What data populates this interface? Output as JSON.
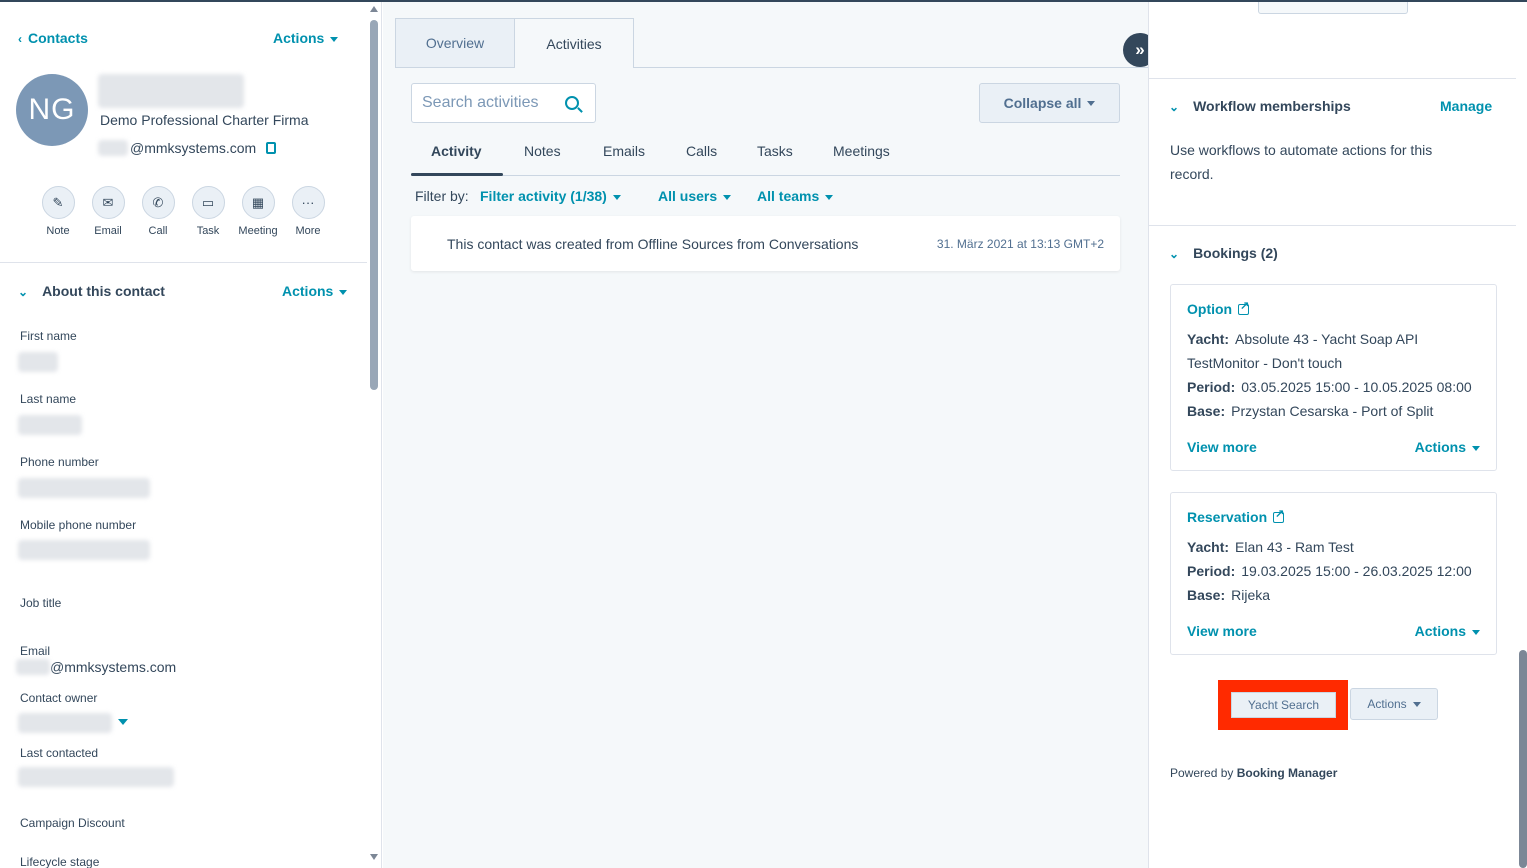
{
  "left": {
    "back_label": "Contacts",
    "header_actions": "Actions",
    "avatar_initials": "NG",
    "company": "Demo Professional Charter Firma",
    "email_domain": "@mmksystems.com",
    "quick_actions": [
      {
        "label": "Note",
        "icon": "edit-icon"
      },
      {
        "label": "Email",
        "icon": "envelope-icon"
      },
      {
        "label": "Call",
        "icon": "phone-icon"
      },
      {
        "label": "Task",
        "icon": "task-icon"
      },
      {
        "label": "Meeting",
        "icon": "calendar-icon"
      },
      {
        "label": "More",
        "icon": "more-icon"
      }
    ],
    "section_title": "About this contact",
    "section_actions": "Actions",
    "props": {
      "first_name": "First name",
      "last_name": "Last name",
      "phone": "Phone number",
      "mobile": "Mobile phone number",
      "job_title": "Job title",
      "email": "Email",
      "email_value": "@mmksystems.com",
      "owner": "Contact owner",
      "last_contacted": "Last contacted",
      "campaign": "Campaign Discount",
      "lifecycle": "Lifecycle stage"
    }
  },
  "mid": {
    "tabs": [
      "Overview",
      "Activities"
    ],
    "search_placeholder": "Search activities",
    "collapse_label": "Collapse all",
    "subtabs": [
      "Activity",
      "Notes",
      "Emails",
      "Calls",
      "Tasks",
      "Meetings"
    ],
    "filter_by": "Filter by:",
    "filter_activity": "Filter activity (1/38)",
    "all_users": "All users",
    "all_teams": "All teams",
    "activity_text": "This contact was created from Offline Sources from Conversations",
    "activity_time": "31. März 2021 at 13:13 GMT+2"
  },
  "right": {
    "workflow_title": "Workflow memberships",
    "manage": "Manage",
    "workflow_desc": "Use workflows to automate actions for this record.",
    "bookings_title": "Bookings (2)",
    "bookings": [
      {
        "title": "Option",
        "yacht_label": "Yacht:",
        "yacht": "Absolute 43 - Yacht Soap API TestMonitor - Don't touch",
        "period_label": "Period:",
        "period": "03.05.2025 15:00 - 10.05.2025 08:00",
        "base_label": "Base:",
        "base": "Przystan Cesarska - Port of Split",
        "view_more": "View more",
        "actions": "Actions"
      },
      {
        "title": "Reservation",
        "yacht_label": "Yacht:",
        "yacht": "Elan 43 - Ram Test",
        "period_label": "Period:",
        "period": "19.03.2025 15:00 - 26.03.2025 12:00",
        "base_label": "Base:",
        "base": "Rijeka",
        "view_more": "View more",
        "actions": "Actions"
      }
    ],
    "yacht_search": "Yacht Search",
    "actions": "Actions",
    "powered_by": "Powered by",
    "powered_brand": "Booking Manager"
  },
  "colors": {
    "accent": "#0091ae",
    "text": "#33475b",
    "highlight": "#ff2a00"
  }
}
